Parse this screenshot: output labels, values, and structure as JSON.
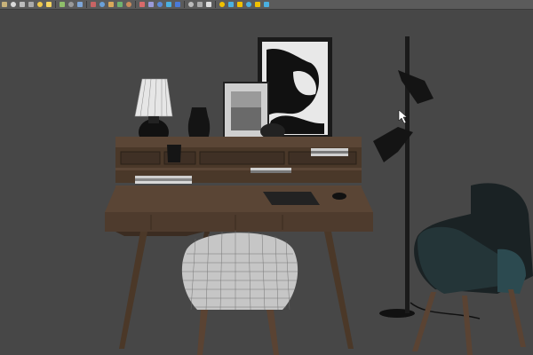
{
  "toolbar": {
    "icons": [
      {
        "name": "teapot-icon",
        "color": "#c8b27a"
      },
      {
        "name": "sphere-icon",
        "color": "#d9d9d9"
      },
      {
        "name": "cone-icon",
        "color": "#bdbdbd"
      },
      {
        "name": "torus-icon",
        "color": "#aaaaaa"
      },
      {
        "name": "light-icon",
        "color": "#f0c84a"
      },
      {
        "name": "sun-icon",
        "color": "#f4d35e"
      },
      {
        "name": "particle-icon",
        "color": "#8fbf6a"
      },
      {
        "name": "grid-icon",
        "color": "#9a9a9a"
      },
      {
        "name": "wrench-icon",
        "color": "#7ea6d8"
      },
      {
        "name": "modifier-icon",
        "color": "#c86464"
      },
      {
        "name": "network-icon",
        "color": "#6aa0d8"
      },
      {
        "name": "material-icon",
        "color": "#d8a85a"
      },
      {
        "name": "tree-icon",
        "color": "#6fb26f"
      },
      {
        "name": "paint-icon",
        "color": "#c88a5a"
      },
      {
        "name": "render-setup-icon",
        "color": "#d86a6a"
      },
      {
        "name": "render-frame-icon",
        "color": "#9a9ad8"
      },
      {
        "name": "globe-icon",
        "color": "#5a8ad8"
      },
      {
        "name": "render-icon",
        "color": "#4ab0e0"
      },
      {
        "name": "teapot-render-icon",
        "color": "#4a7ad8"
      },
      {
        "name": "file-icon",
        "color": "#bbbbbb"
      },
      {
        "name": "layers-icon",
        "color": "#aaaaaa"
      },
      {
        "name": "help-icon",
        "color": "#dddddd"
      },
      {
        "name": "chart-icon",
        "color": "#f0c000"
      },
      {
        "name": "align-icon",
        "color": "#4ab0e0"
      },
      {
        "name": "snap-icon",
        "color": "#f0c000"
      },
      {
        "name": "flask-icon",
        "color": "#4ab0e0"
      },
      {
        "name": "letter-m-icon",
        "color": "#f0c000"
      },
      {
        "name": "settings-icon",
        "color": "#4ab0e0"
      }
    ]
  },
  "scene": {
    "background": "#474747",
    "wood": "#5b4636",
    "wood_dark": "#3f3025",
    "black": "#161616",
    "teal": "#2c4a50"
  }
}
